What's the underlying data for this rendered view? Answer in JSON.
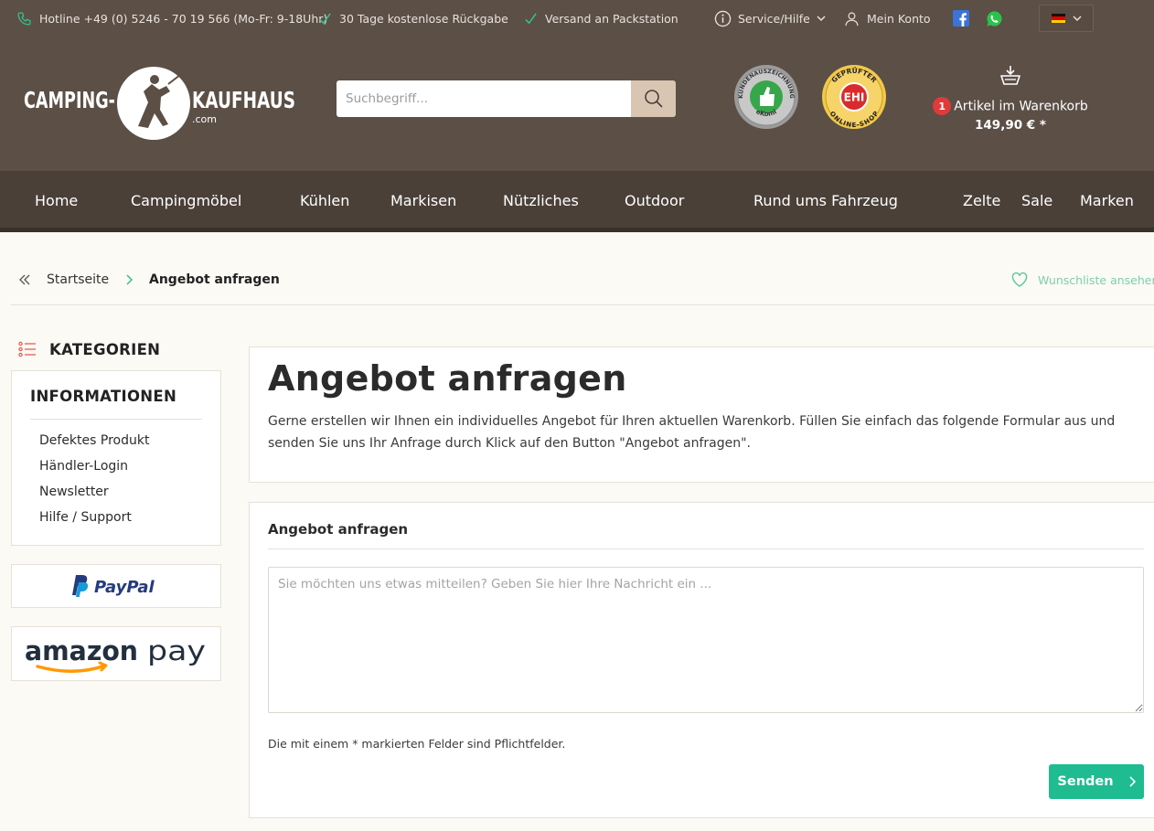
{
  "topbar": {
    "hotline": "Hotline +49 (0) 5246 - 70 19 566 (Mo-Fr: 9-18Uhr)",
    "returns": "30 Tage kostenlose Rückgabe",
    "packstation": "Versand an Packstation",
    "service": "Service/Hilfe",
    "account": "Mein Konto",
    "language": "de"
  },
  "header": {
    "logo_left": "CAMPING-",
    "logo_right": "KAUFHAUS",
    "logo_domain": ".com",
    "search_placeholder": "Suchbegriff...",
    "seal_ekomi_top": "KUNDENAUSZEICHNUNG",
    "seal_ekomi_bottom": "eKomi",
    "seal_ehi_top": "GEPRÜFTER",
    "seal_ehi_center": "EHI",
    "seal_ehi_bottom": "ONLINE-SHOP",
    "cart_count": "1",
    "cart_label": "Artikel im Warenkorb",
    "cart_total": "149,90 € *"
  },
  "nav": {
    "items": [
      "Home",
      "Campingmöbel",
      "Kühlen",
      "Markisen",
      "Nützliches",
      "Outdoor",
      "Rund ums Fahrzeug",
      "Zelte",
      "Sale",
      "Marken"
    ]
  },
  "breadcrumb": {
    "home": "Startseite",
    "current": "Angebot anfragen",
    "wishlist": "Wunschliste ansehen"
  },
  "sidebar": {
    "categories_title": "KATEGORIEN",
    "info_title": "INFORMATIONEN",
    "links": [
      "Defektes Produkt",
      "Händler-Login",
      "Newsletter",
      "Hilfe / Support"
    ],
    "paypal": "PayPal",
    "amazon_pay_a": "amazon",
    "amazon_pay_b": "pay"
  },
  "main": {
    "title": "Angebot anfragen",
    "intro": "Gerne erstellen wir Ihnen ein individuelles Angebot für Ihren aktuellen Warenkorb. Füllen Sie einfach das folgende Formular aus und senden Sie uns Ihr Anfrage durch Klick auf den Button \"Angebot anfragen\".",
    "form_title": "Angebot anfragen",
    "message_placeholder": "Sie möchten uns etwas mitteilen? Geben Sie hier Ihre Nachricht ein ...",
    "required_note": "Die mit einem * markierten Felder sind Pflichtfelder.",
    "send_label": "Senden"
  },
  "colors": {
    "header_bg": "#5b4f46",
    "nav_bg": "#4a4038",
    "accent_green": "#1fbb91",
    "badge_red": "#e03a3a",
    "search_button": "#d8c6b3"
  }
}
